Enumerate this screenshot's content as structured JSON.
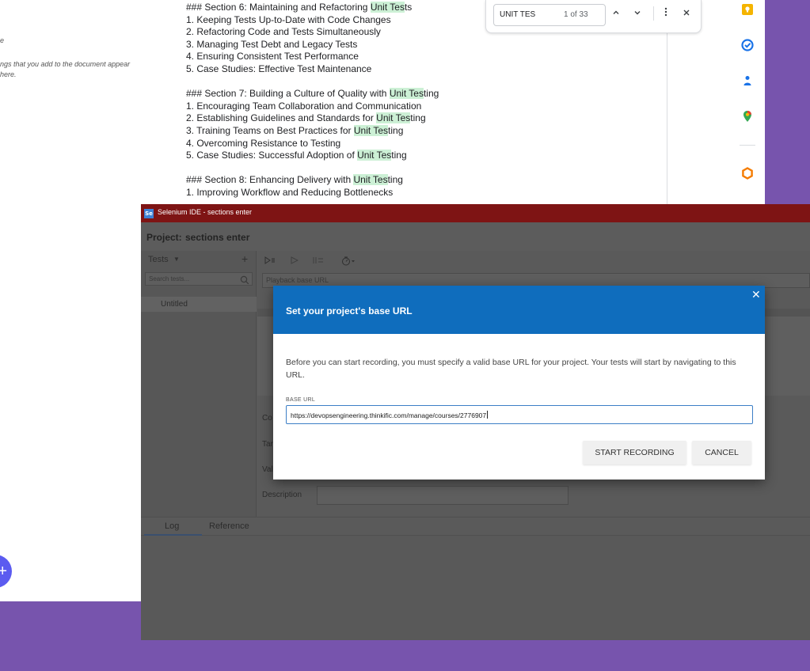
{
  "doc": {
    "outline_fragment_1": "e",
    "outline_fragment_2": "ngs that you add to the document appear here.",
    "fab_icon": "+",
    "lines": [
      {
        "type": "line",
        "segments": [
          {
            "t": "### Section 6: Maintaining and Refactoring "
          },
          {
            "t": "Unit Tes",
            "hl": true
          },
          {
            "t": "ts"
          }
        ]
      },
      {
        "type": "line",
        "segments": [
          {
            "t": "1. Keeping Tests Up-to-Date with Code Changes"
          }
        ]
      },
      {
        "type": "line",
        "segments": [
          {
            "t": "2. Refactoring Code and Tests Simultaneously"
          }
        ]
      },
      {
        "type": "line",
        "segments": [
          {
            "t": "3. Managing Test Debt and Legacy Tests"
          }
        ]
      },
      {
        "type": "line",
        "segments": [
          {
            "t": "4. Ensuring Consistent Test Performance"
          }
        ]
      },
      {
        "type": "line",
        "segments": [
          {
            "t": "5. Case Studies: Effective Test Maintenance"
          }
        ]
      },
      {
        "type": "gap"
      },
      {
        "type": "line",
        "segments": [
          {
            "t": "### Section 7: Building a Culture of Quality with "
          },
          {
            "t": "Unit Tes",
            "hl": true
          },
          {
            "t": "ting"
          }
        ]
      },
      {
        "type": "line",
        "segments": [
          {
            "t": "1. Encouraging Team Collaboration and Communication"
          }
        ]
      },
      {
        "type": "line",
        "segments": [
          {
            "t": "2. Establishing Guidelines and Standards for "
          },
          {
            "t": "Unit Tes",
            "hl": true
          },
          {
            "t": "ting"
          }
        ]
      },
      {
        "type": "line",
        "segments": [
          {
            "t": "3. Training Teams on Best Practices for "
          },
          {
            "t": "Unit Tes",
            "hl": true
          },
          {
            "t": "ting"
          }
        ]
      },
      {
        "type": "line",
        "segments": [
          {
            "t": "4. Overcoming Resistance to Testing"
          }
        ]
      },
      {
        "type": "line",
        "segments": [
          {
            "t": "5. Case Studies: Successful Adoption of "
          },
          {
            "t": "Unit Tes",
            "hl": true
          },
          {
            "t": "ting"
          }
        ]
      },
      {
        "type": "gap"
      },
      {
        "type": "line",
        "segments": [
          {
            "t": "### Section 8: Enhancing Delivery with "
          },
          {
            "t": "Unit Tes",
            "hl": true
          },
          {
            "t": "ting"
          }
        ]
      },
      {
        "type": "line",
        "segments": [
          {
            "t": "1. Improving Workflow and Reducing Bottlenecks"
          }
        ]
      }
    ],
    "highlight_color": "#ccf0d5"
  },
  "find_bar": {
    "query": "UNIT TES",
    "count": "1 of 33",
    "prev_icon": "chevron-up-icon",
    "next_icon": "chevron-down-icon",
    "more_icon": "more-vert-icon",
    "close_icon": "close-icon"
  },
  "side_panel": {
    "icons": [
      "keep-icon",
      "tasks-icon",
      "contacts-icon",
      "maps-icon",
      "addon-icon"
    ]
  },
  "ide": {
    "window_title": "Selenium IDE - sections enter",
    "logo": "Se",
    "project_label": "Project:",
    "project_name": "sections enter",
    "tests_label": "Tests",
    "tests_add": "+",
    "search_placeholder": "Search tests...",
    "test_items": [
      "Untitled"
    ],
    "base_url_placeholder": "Playback base URL",
    "field_labels": {
      "command": "Co",
      "target": "Tar",
      "value": "Val",
      "description": "Description"
    },
    "bottom_tabs": {
      "log": "Log",
      "reference": "Reference"
    },
    "titlebar_color": "#7e1414"
  },
  "modal": {
    "title": "Set your project's base URL",
    "body": "Before you can start recording, you must specify a valid base URL for your project. Your tests will start by navigating to this URL.",
    "base_url_label": "BASE URL",
    "base_url_value": "https://devopsengineering.thinkific.com/manage/courses/2776907",
    "start_button": "START RECORDING",
    "cancel_button": "CANCEL",
    "header_color": "#0f6dbd"
  }
}
